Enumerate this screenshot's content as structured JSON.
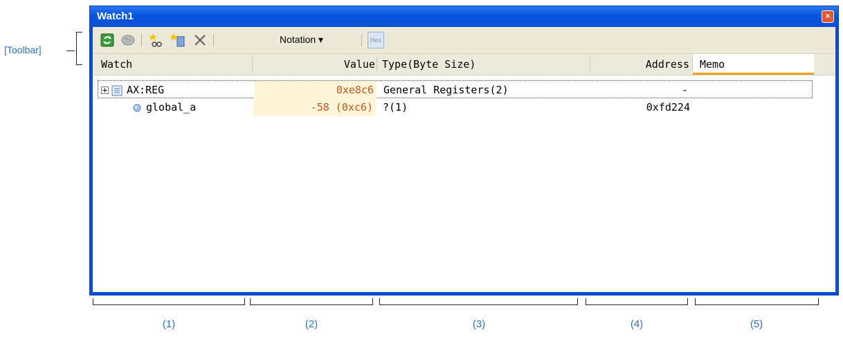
{
  "annotation": {
    "toolbar_label": "[Toolbar]"
  },
  "window": {
    "title": "Watch1",
    "close_glyph": "×"
  },
  "toolbar": {
    "buttons": [
      {
        "icon": "refresh-icon"
      },
      {
        "icon": "brain-icon"
      },
      {
        "icon": "add-watch-icon"
      },
      {
        "icon": "register-icon"
      },
      {
        "icon": "delete-icon"
      }
    ],
    "notation_label": "Notation",
    "notation_arrow": "▾",
    "hex_label": "Hex"
  },
  "table": {
    "headers": {
      "watch": "Watch",
      "value": "Value",
      "type": "Type(Byte Size)",
      "address": "Address",
      "memo": "Memo"
    },
    "rows": [
      {
        "expander": "+",
        "name": "AX:REG",
        "value": "0xe8c6",
        "type": "General Registers(2)",
        "address": "-",
        "memo": ""
      },
      {
        "expander": "",
        "name": "global_a",
        "value": "-58 (0xc6)",
        "type": "?(1)",
        "address": "0xfd224",
        "memo": ""
      }
    ]
  },
  "column_labels": [
    "(1)",
    "(2)",
    "(3)",
    "(4)",
    "(5)"
  ],
  "colors": {
    "title_bar": "#0755df",
    "value_text": "#c8531f",
    "value_bg": "#fff5d9",
    "accent": "#f3a21d",
    "annotation": "#2f6fbf"
  }
}
